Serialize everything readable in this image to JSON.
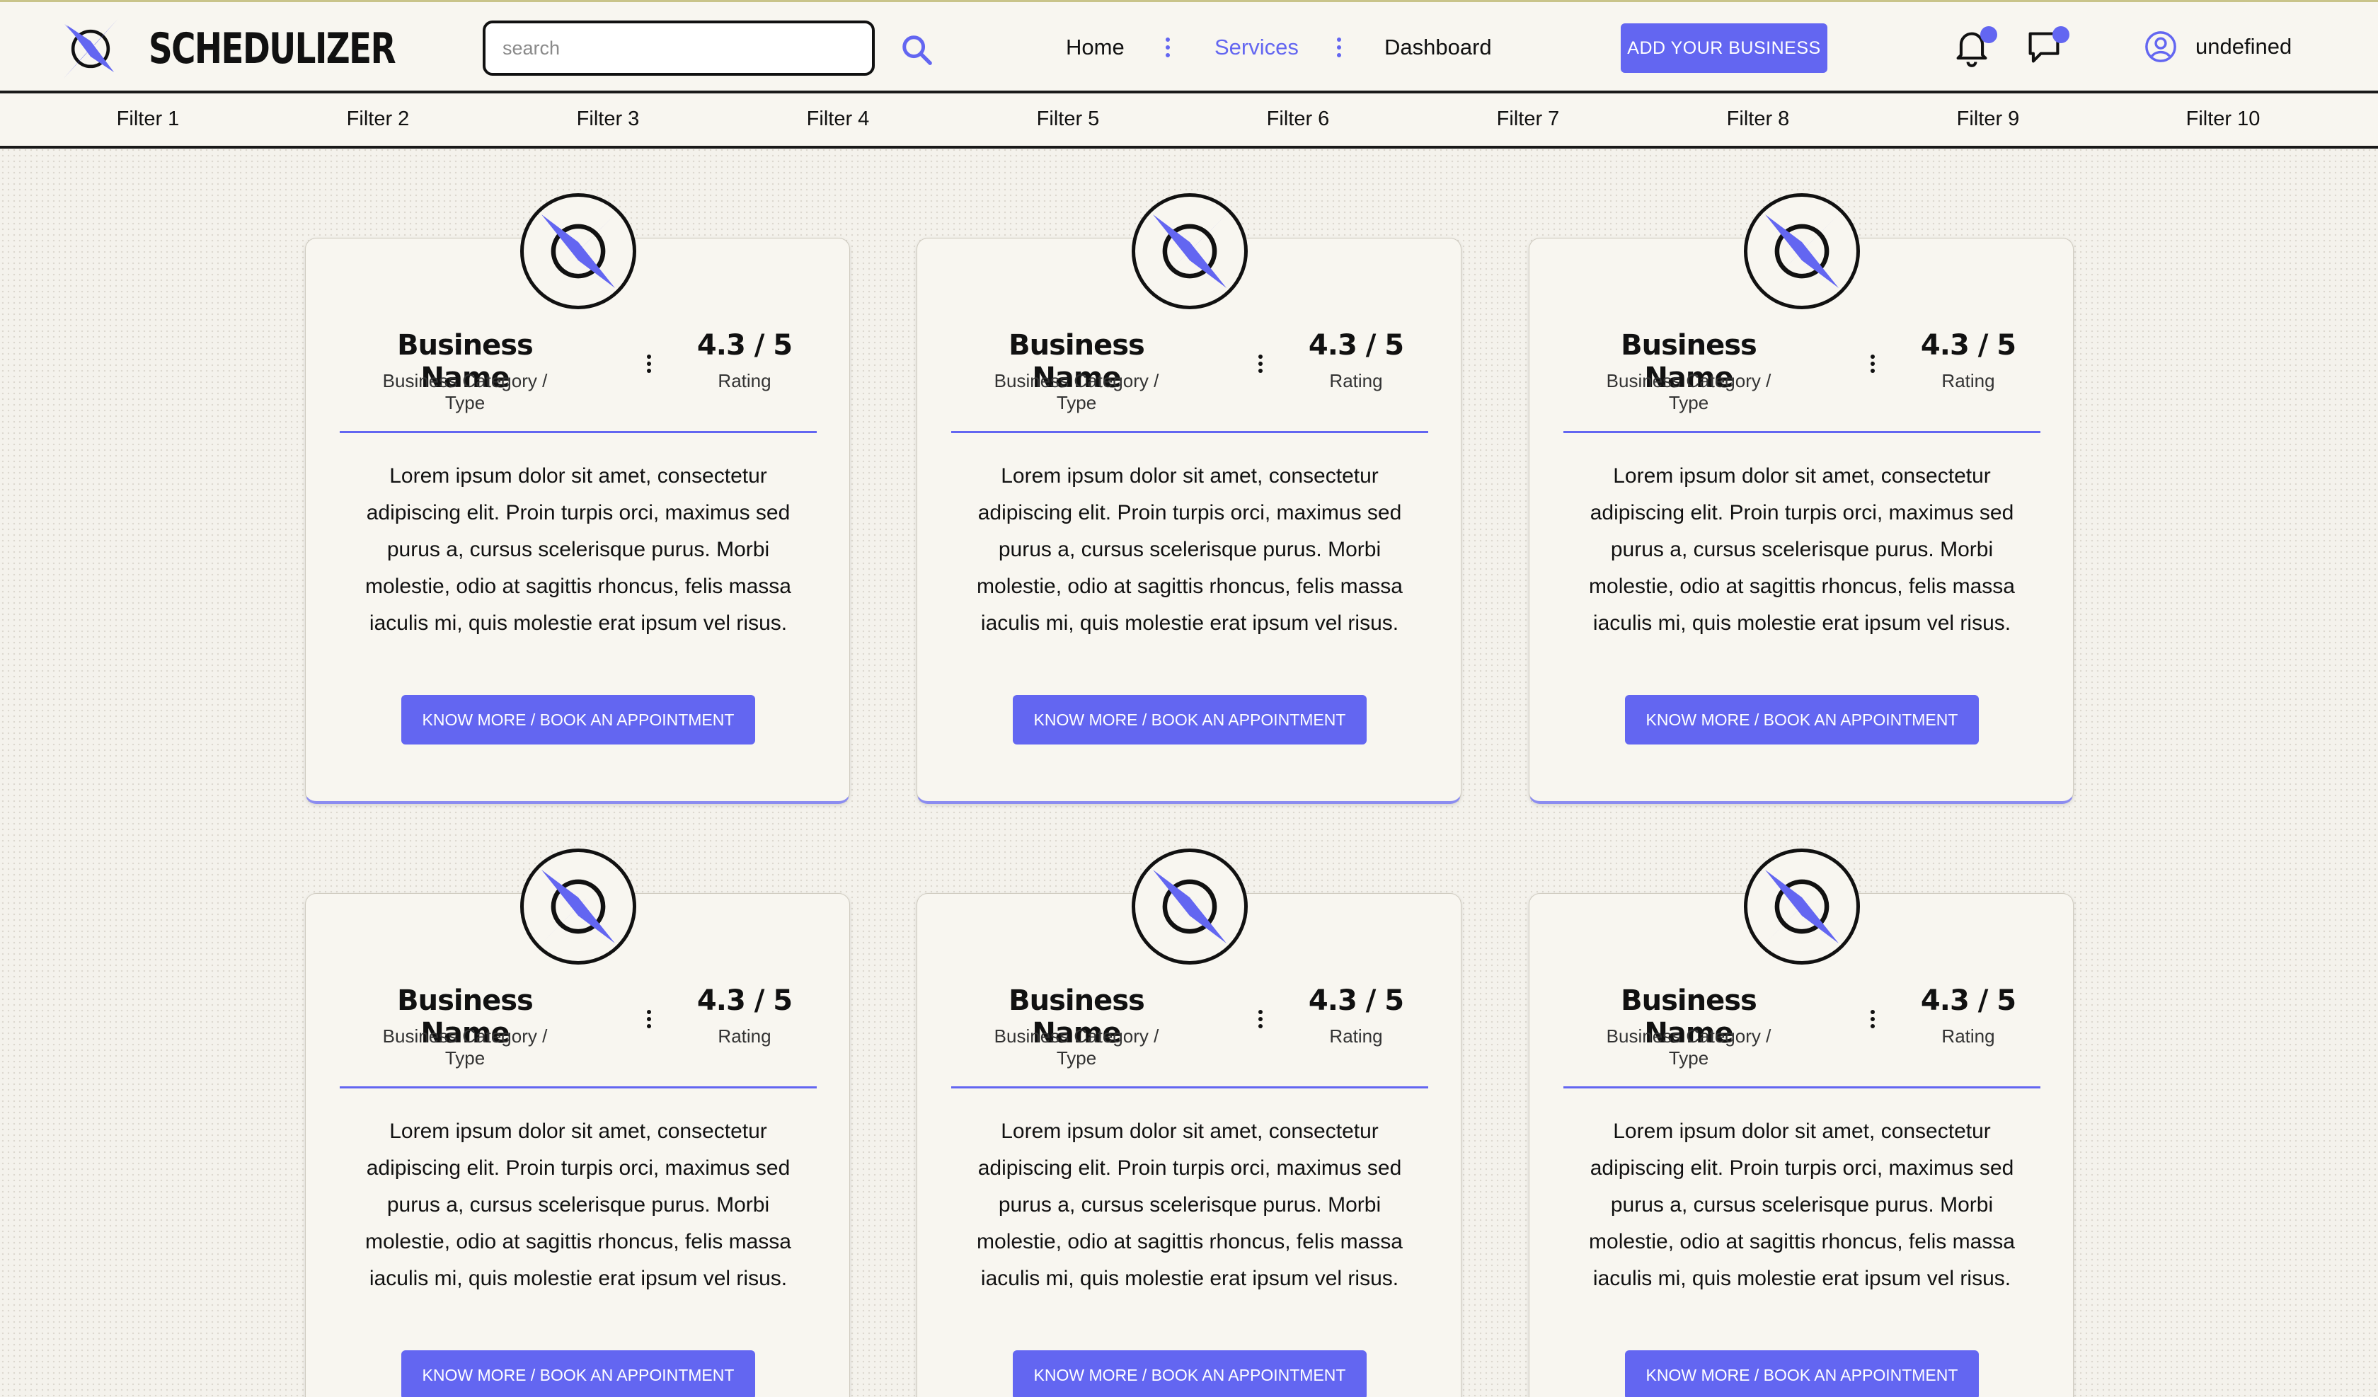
{
  "header": {
    "brand_name": "SCHEDULIZER",
    "search_placeholder": "search",
    "search_value": "",
    "nav": [
      {
        "label": "Home",
        "active": false
      },
      {
        "label": "Services",
        "active": true
      },
      {
        "label": "Dashboard",
        "active": false
      }
    ],
    "add_business_label": "ADD YOUR BUSINESS",
    "notifications_icon": "bell-icon",
    "messages_icon": "chat-icon",
    "user_name": "undefined"
  },
  "filters": [
    "Filter 1",
    "Filter 2",
    "Filter 3",
    "Filter 4",
    "Filter 5",
    "Filter 6",
    "Filter 7",
    "Filter 8",
    "Filter 9",
    "Filter 10"
  ],
  "cards": [
    {
      "name": "Business Name",
      "category": "Business Category / Type",
      "rating": "4.3 / 5",
      "rating_label": "Rating",
      "description": "Lorem ipsum dolor sit amet, consectetur adipiscing elit. Proin turpis orci, maximus sed purus a, cursus scelerisque purus. Morbi molestie, odio at sagittis rhoncus, felis massa iaculis mi, quis molestie erat ipsum vel risus.",
      "button_label": "KNOW MORE / BOOK AN APPOINTMENT"
    },
    {
      "name": "Business Name",
      "category": "Business Category / Type",
      "rating": "4.3 / 5",
      "rating_label": "Rating",
      "description": "Lorem ipsum dolor sit amet, consectetur adipiscing elit. Proin turpis orci, maximus sed purus a, cursus scelerisque purus. Morbi molestie, odio at sagittis rhoncus, felis massa iaculis mi, quis molestie erat ipsum vel risus.",
      "button_label": "KNOW MORE / BOOK AN APPOINTMENT"
    },
    {
      "name": "Business Name",
      "category": "Business Category / Type",
      "rating": "4.3 / 5",
      "rating_label": "Rating",
      "description": "Lorem ipsum dolor sit amet, consectetur adipiscing elit. Proin turpis orci, maximus sed purus a, cursus scelerisque purus. Morbi molestie, odio at sagittis rhoncus, felis massa iaculis mi, quis molestie erat ipsum vel risus.",
      "button_label": "KNOW MORE / BOOK AN APPOINTMENT"
    },
    {
      "name": "Business Name",
      "category": "Business Category / Type",
      "rating": "4.3 / 5",
      "rating_label": "Rating",
      "description": "Lorem ipsum dolor sit amet, consectetur adipiscing elit. Proin turpis orci, maximus sed purus a, cursus scelerisque purus. Morbi molestie, odio at sagittis rhoncus, felis massa iaculis mi, quis molestie erat ipsum vel risus.",
      "button_label": "KNOW MORE / BOOK AN APPOINTMENT"
    },
    {
      "name": "Business Name",
      "category": "Business Category / Type",
      "rating": "4.3 / 5",
      "rating_label": "Rating",
      "description": "Lorem ipsum dolor sit amet, consectetur adipiscing elit. Proin turpis orci, maximus sed purus a, cursus scelerisque purus. Morbi molestie, odio at sagittis rhoncus, felis massa iaculis mi, quis molestie erat ipsum vel risus.",
      "button_label": "KNOW MORE / BOOK AN APPOINTMENT"
    },
    {
      "name": "Business Name",
      "category": "Business Category / Type",
      "rating": "4.3 / 5",
      "rating_label": "Rating",
      "description": "Lorem ipsum dolor sit amet, consectetur adipiscing elit. Proin turpis orci, maximus sed purus a, cursus scelerisque purus. Morbi molestie, odio at sagittis rhoncus, felis massa iaculis mi, quis molestie erat ipsum vel risus.",
      "button_label": "KNOW MORE / BOOK AN APPOINTMENT"
    }
  ],
  "colors": {
    "accent": "#6366f1",
    "background": "#f4f2ec",
    "card_background": "#f8f6f0",
    "text": "#111111"
  }
}
